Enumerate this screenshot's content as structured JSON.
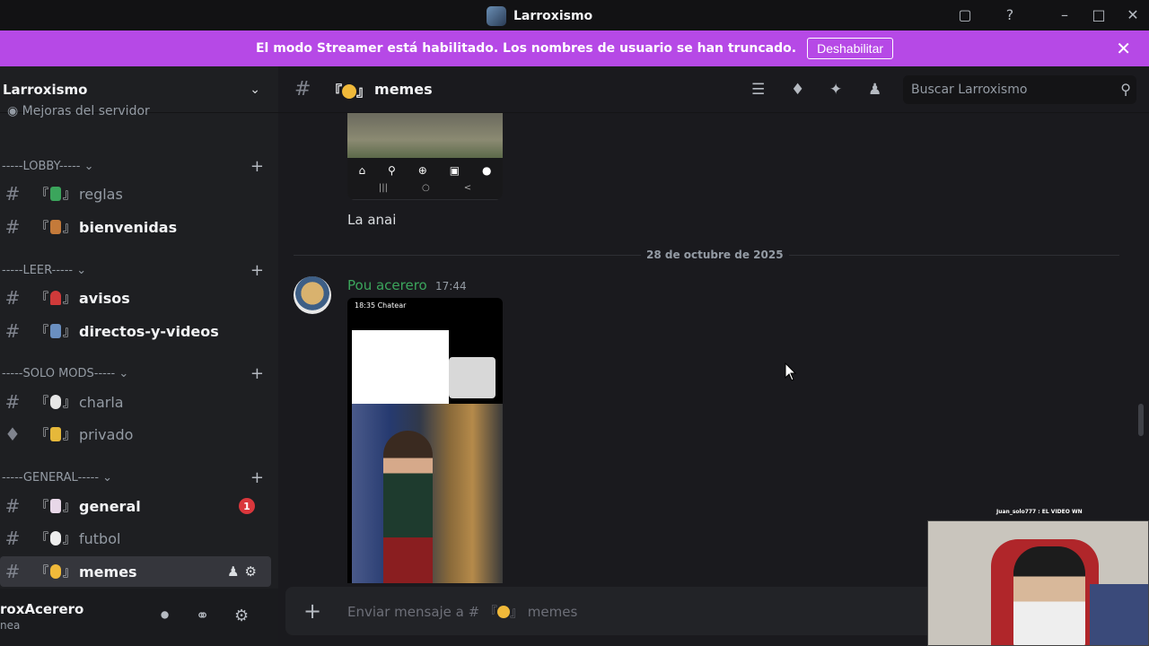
{
  "titlebar": {
    "app_title": "Larroxismo"
  },
  "banner": {
    "message": "El modo Streamer está habilitado. Los nombres de usuario se han truncado.",
    "button": "Deshabilitar"
  },
  "sidebar": {
    "server_name": "Larroxismo",
    "mejoras": "Mejoras del servidor",
    "categories": [
      {
        "label": "-----LOBBY-----"
      },
      {
        "label": "-----LEER-----"
      },
      {
        "label": "-----SOLO MODS-----"
      },
      {
        "label": "-----GENERAL-----"
      }
    ],
    "channels": [
      {
        "label": "reglas"
      },
      {
        "label": "bienvenidas"
      },
      {
        "label": "avisos"
      },
      {
        "label": "directos-y-videos"
      },
      {
        "label": "charla"
      },
      {
        "label": "privado"
      },
      {
        "label": "general",
        "badge": "1"
      },
      {
        "label": "futbol"
      },
      {
        "label": "memes"
      }
    ],
    "user": {
      "name": "roxAcerero",
      "status": "nea"
    }
  },
  "main": {
    "channel_name": "memes",
    "search_placeholder": "Buscar Larroxismo",
    "previous_message": "La anai",
    "date_divider": "28 de octubre de 2025",
    "author": "Pou acerero",
    "timestamp": "17:44",
    "video_status": "18:35 Chatear",
    "composer_placeholder": "Enviar mensaje a #",
    "composer_channel": "memes"
  },
  "stream": {
    "caption": "Juan_solo777 : EL VIDEO WN"
  },
  "colors": {
    "banner": "#b649e6",
    "author": "#3ba55c",
    "badge": "#da373c"
  }
}
